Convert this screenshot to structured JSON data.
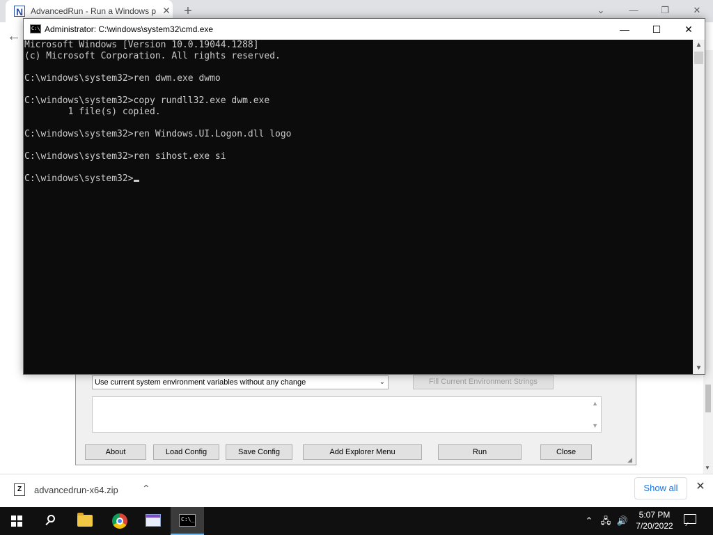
{
  "browser": {
    "tab_title": "AdvancedRun - Run a Windows p",
    "tab_favicon": "N",
    "tab_close": "✕",
    "new_tab": "+",
    "minimize": "⌄",
    "restore": "—",
    "maximize": "❐",
    "close": "✕",
    "back": "←"
  },
  "cmd": {
    "title": "Administrator: C:\\windows\\system32\\cmd.exe",
    "icon_text": "C:\\",
    "minimize": "—",
    "maximize": "☐",
    "close": "✕",
    "lines": [
      "Microsoft Windows [Version 10.0.19044.1288]",
      "(c) Microsoft Corporation. All rights reserved.",
      "",
      "C:\\windows\\system32>ren dwm.exe dwmo",
      "",
      "C:\\windows\\system32>copy rundll32.exe dwm.exe",
      "        1 file(s) copied.",
      "",
      "C:\\windows\\system32>ren Windows.UI.Logon.dll logo",
      "",
      "C:\\windows\\system32>ren sihost.exe si",
      "",
      "C:\\windows\\system32>"
    ],
    "scroll_up": "▲",
    "scroll_down": "▼"
  },
  "advancedrun": {
    "env_select": "Use current system environment variables without any change",
    "fill_env_button": "Fill Current Environment Strings",
    "about": "About",
    "load_config": "Load Config",
    "save_config": "Save Config",
    "add_explorer_menu": "Add Explorer Menu",
    "run": "Run",
    "close": "Close"
  },
  "downloads": {
    "file_name": "advancedrun-x64.zip",
    "show_all": "Show all",
    "close": "✕"
  },
  "taskbar": {
    "time": "5:07 PM",
    "date": "7/20/2022",
    "cmd_icon_text": "C:\\_",
    "tray_chevron": "⌃",
    "network": "🖧",
    "volume": "🔊"
  },
  "colors": {
    "console_bg": "#0c0c0c",
    "console_fg": "#cccccc",
    "taskbar_bg": "#101010",
    "accent": "#1a73e8"
  }
}
